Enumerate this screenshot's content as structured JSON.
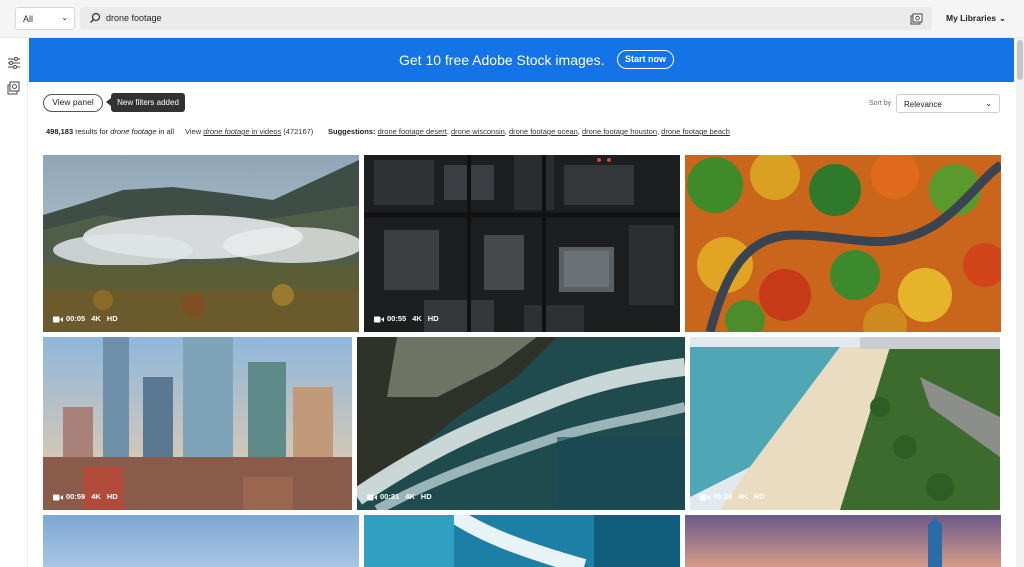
{
  "topbar": {
    "scope": "All",
    "search_query": "drone footage",
    "libraries_label": "My Libraries"
  },
  "banner": {
    "text": "Get 10 free Adobe Stock images.",
    "button": "Start now"
  },
  "controls": {
    "view_panel": "View panel",
    "tooltip": "New filters added",
    "sort_label": "Sort by",
    "sort_value": "Relevance"
  },
  "results": {
    "count": "498,183",
    "mid": " results for ",
    "query": "drone footage",
    "tail": " in all",
    "view_prefix": "View ",
    "view_query": "drone footage",
    "view_link": " in videos",
    "view_count": " (472167)",
    "suggestions_label": "Suggestions:",
    "suggestions": [
      "drone footage desert",
      "drone wisconsin",
      "drone footage ocean",
      "drone footage houston",
      "drone footage beach"
    ]
  },
  "videos": [
    {
      "duration": "00:05",
      "q1": "4K",
      "q2": "HD",
      "scene": "misty-mountains"
    },
    {
      "duration": "00:55",
      "q1": "4K",
      "q2": "HD",
      "scene": "city-top-down"
    },
    {
      "duration": "",
      "q1": "",
      "q2": "",
      "scene": "autumn-road"
    },
    {
      "duration": "00:59",
      "q1": "4K",
      "q2": "HD",
      "scene": "skyscrapers"
    },
    {
      "duration": "00:31",
      "q1": "4K",
      "q2": "HD",
      "scene": "ocean-waves"
    },
    {
      "duration": "00:29",
      "q1": "4K",
      "q2": "HD",
      "scene": "beach"
    },
    {
      "duration": "",
      "q1": "",
      "q2": "",
      "scene": "sky"
    },
    {
      "duration": "",
      "q1": "",
      "q2": "",
      "scene": "surf"
    },
    {
      "duration": "",
      "q1": "",
      "q2": "",
      "scene": "dusk-tower"
    }
  ],
  "colors": {
    "banner": "#1473e6",
    "tooltip": "#323232"
  }
}
